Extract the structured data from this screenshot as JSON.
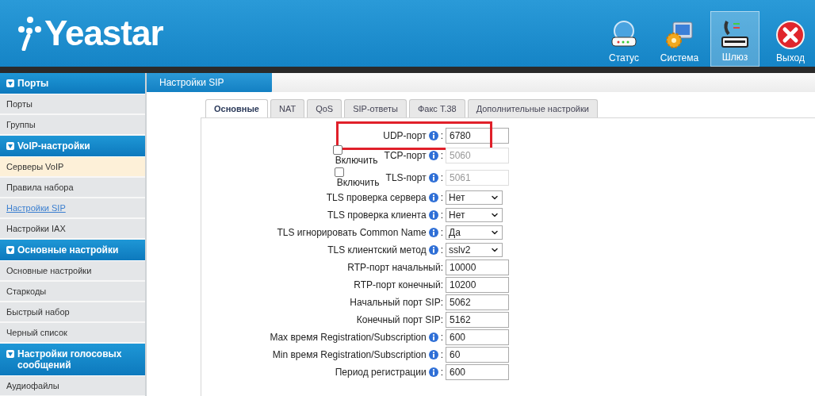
{
  "header": {
    "logo": "Yeastar",
    "nav": [
      {
        "label": "Статус",
        "kind": "status",
        "selected": false
      },
      {
        "label": "Система",
        "kind": "system",
        "selected": false
      },
      {
        "label": "Шлюз",
        "kind": "gateway",
        "selected": true
      },
      {
        "label": "Выход",
        "kind": "exit",
        "selected": false
      }
    ]
  },
  "sidebar": {
    "sections": [
      {
        "title": "Порты",
        "expanded": true,
        "items": [
          {
            "label": "Порты",
            "selected": false,
            "highlighted": false
          },
          {
            "label": "Группы",
            "selected": false,
            "highlighted": false
          }
        ]
      },
      {
        "title": "VoIP-настройки",
        "expanded": true,
        "items": [
          {
            "label": "Серверы VoIP",
            "selected": false,
            "highlighted": true
          },
          {
            "label": "Правила набора",
            "selected": false,
            "highlighted": false
          },
          {
            "label": "Настройки SIP",
            "selected": true,
            "highlighted": false
          },
          {
            "label": "Настройки IAX",
            "selected": false,
            "highlighted": false
          }
        ]
      },
      {
        "title": "Основные настройки",
        "expanded": true,
        "items": [
          {
            "label": "Основные настройки",
            "selected": false,
            "highlighted": false
          },
          {
            "label": "Старкоды",
            "selected": false,
            "highlighted": false
          },
          {
            "label": "Быстрый набор",
            "selected": false,
            "highlighted": false
          },
          {
            "label": "Черный список",
            "selected": false,
            "highlighted": false
          }
        ]
      },
      {
        "title": "Настройки голосовых сообщений",
        "expanded": true,
        "items": [
          {
            "label": "Аудиофайлы",
            "selected": false,
            "highlighted": false
          }
        ]
      }
    ]
  },
  "page_title": "Настройки SIP",
  "tabs": [
    {
      "label": "Основные",
      "selected": true
    },
    {
      "label": "NAT",
      "selected": false
    },
    {
      "label": "QoS",
      "selected": false
    },
    {
      "label": "SIP-ответы",
      "selected": false
    },
    {
      "label": "Факс T.38",
      "selected": false
    },
    {
      "label": "Дополнительные настройки",
      "selected": false
    }
  ],
  "form": [
    {
      "kind": "text",
      "label": "UDP-порт",
      "info": true,
      "suffix": ":",
      "value": "6780",
      "highlighted": true
    },
    {
      "kind": "enable_text",
      "label": "TCP-порт",
      "info": true,
      "suffix": ":",
      "value": "5060",
      "enable_label": "Включить",
      "checked": false,
      "disabled": true,
      "highlighted": false
    },
    {
      "kind": "enable_text",
      "label": "TLS-порт",
      "info": true,
      "suffix": ":",
      "value": "5061",
      "enable_label": "Включить",
      "checked": false,
      "disabled": true,
      "highlighted": false
    },
    {
      "kind": "select",
      "label": "TLS проверка сервера",
      "info": true,
      "suffix": ":",
      "value": "Нет",
      "highlighted": false
    },
    {
      "kind": "select",
      "label": "TLS проверка клиента",
      "info": true,
      "suffix": ":",
      "value": "Нет",
      "highlighted": false
    },
    {
      "kind": "select",
      "label": "TLS игнорировать Common Name",
      "info": true,
      "suffix": ":",
      "value": "Да",
      "highlighted": false
    },
    {
      "kind": "select",
      "label": "TLS клиентский метод",
      "info": true,
      "suffix": ":",
      "value": "sslv2",
      "highlighted": false
    },
    {
      "kind": "text",
      "label": "RTP-порт начальный:",
      "info": false,
      "value": "10000",
      "highlighted": false
    },
    {
      "kind": "text",
      "label": "RTP-порт конечный:",
      "info": false,
      "value": "10200",
      "highlighted": false
    },
    {
      "kind": "text",
      "label": "Начальный порт SIP:",
      "info": false,
      "value": "5062",
      "highlighted": false
    },
    {
      "kind": "text",
      "label": "Конечный порт SIP:",
      "info": false,
      "value": "5162",
      "highlighted": false
    },
    {
      "kind": "text",
      "label": "Max время Registration/Subscription",
      "info": true,
      "suffix": ":",
      "value": "600",
      "highlighted": false
    },
    {
      "kind": "text",
      "label": "Min время Registration/Subscription",
      "info": true,
      "suffix": ":",
      "value": "60",
      "highlighted": false
    },
    {
      "kind": "text",
      "label": "Период регистрации",
      "info": true,
      "suffix": ":",
      "value": "600",
      "highlighted": false
    }
  ]
}
